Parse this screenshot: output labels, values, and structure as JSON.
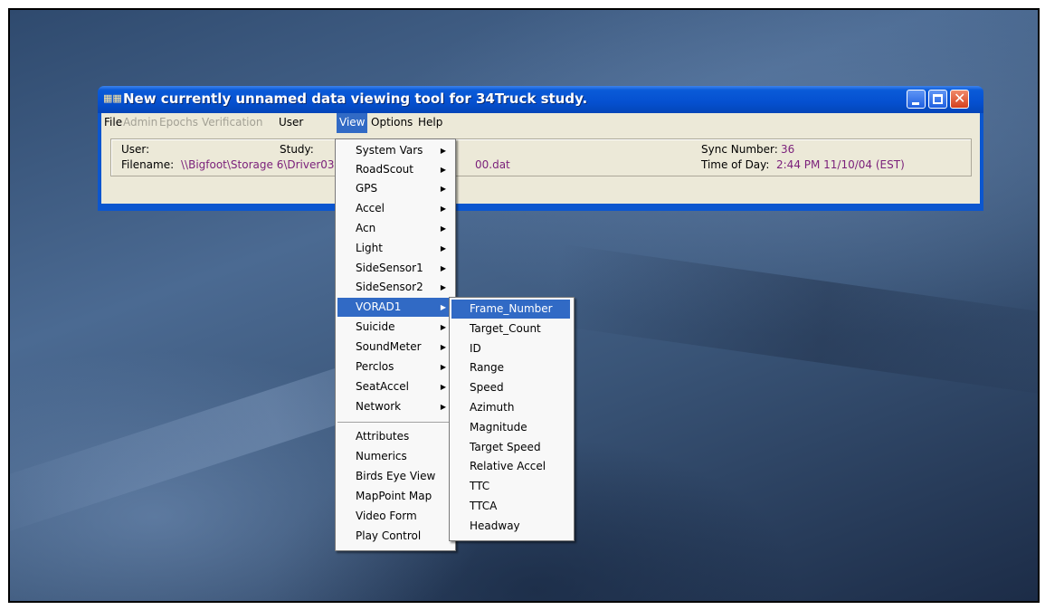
{
  "window": {
    "title": "New currently unnamed data viewing tool for 34Truck study.",
    "icon": "app-icon"
  },
  "menubar": [
    {
      "label": "File",
      "enabled": true
    },
    {
      "label": "Admin",
      "enabled": false
    },
    {
      "label": "Epochs",
      "enabled": false
    },
    {
      "label": "Verification",
      "enabled": false
    },
    {
      "label": "User",
      "enabled": true
    },
    {
      "label": "View",
      "enabled": true,
      "active": true
    },
    {
      "label": "Options",
      "enabled": true
    },
    {
      "label": "Help",
      "enabled": true
    }
  ],
  "info": {
    "user_label": "User:",
    "study_label": "Study:",
    "filename_label": "Filename:",
    "filename_value_left": "\\\\Bigfoot\\Storage 6\\Driver033",
    "filename_value_right": "00.dat",
    "sync_label": "Sync Number:",
    "sync_value": "36",
    "time_label": "Time of Day:",
    "time_value": "2:44 PM  11/10/04 (EST)"
  },
  "view_menu": {
    "group1": [
      "System Vars",
      "RoadScout",
      "GPS",
      "Accel",
      "Acn",
      "Light",
      "SideSensor1",
      "SideSensor2",
      "VORAD1",
      "Suicide",
      "SoundMeter",
      "Perclos",
      "SeatAccel",
      "Network"
    ],
    "highlighted": "VORAD1",
    "group2": [
      "Attributes",
      "Numerics",
      "Birds Eye View",
      "MapPoint Map",
      "Video Form",
      "Play Control"
    ]
  },
  "vorad_submenu": {
    "items": [
      "Frame_Number",
      "Target_Count",
      "ID",
      "Range",
      "Speed",
      "Azimuth",
      "Magnitude",
      "Target Speed",
      "Relative Accel",
      "TTC",
      "TTCA",
      "Headway"
    ],
    "highlighted": "Frame_Number"
  },
  "colors": {
    "titlebar": "#0550d0",
    "menu_highlight": "#316ac5",
    "value_text": "#7a1f7a",
    "window_face": "#ece9d8"
  }
}
